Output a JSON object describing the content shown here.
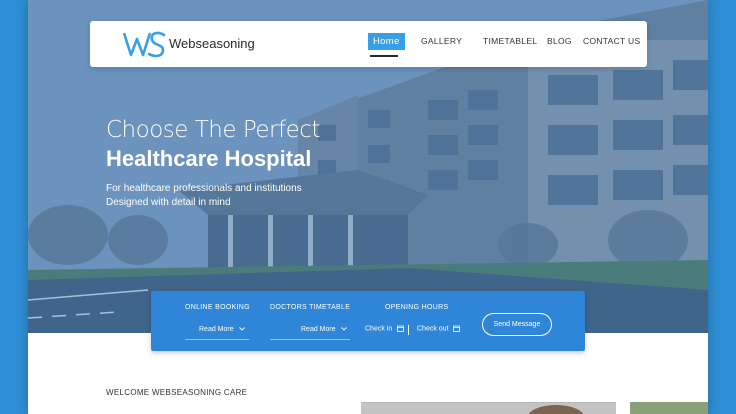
{
  "brand": {
    "name": "Webseasoning",
    "logo_text": "WS"
  },
  "nav": {
    "items": [
      {
        "label": "Home",
        "active": true
      },
      {
        "label": "GALLERY",
        "active": false
      },
      {
        "label": "TIMETABLEL",
        "active": false
      },
      {
        "label": "BLOG",
        "active": false
      },
      {
        "label": "CONTACT US",
        "active": false
      }
    ]
  },
  "hero": {
    "title_line1": "Choose The Perfect",
    "title_line2": "Healthcare Hospital",
    "subtitle_line1": "For healthcare professionals and institutions",
    "subtitle_line2": "Designed with detail in mind"
  },
  "booking": {
    "online_booking": {
      "heading": "ONLINE BOOKING",
      "link": "Read More"
    },
    "doctors_timetable": {
      "heading": "DOCTORS TIMETABLE",
      "link": "Read More"
    },
    "opening_hours": {
      "heading": "OPENING HOURS",
      "check_in": "Check in",
      "check_out": "Check out"
    },
    "send_button": "Send Message"
  },
  "welcome": {
    "heading": "WELCOME WEBSEASONING CARE"
  },
  "colors": {
    "accent": "#2f86d8",
    "nav_active": "#3a9ee4",
    "logo": "#3aa0e6",
    "background": "#2e8fd6"
  }
}
